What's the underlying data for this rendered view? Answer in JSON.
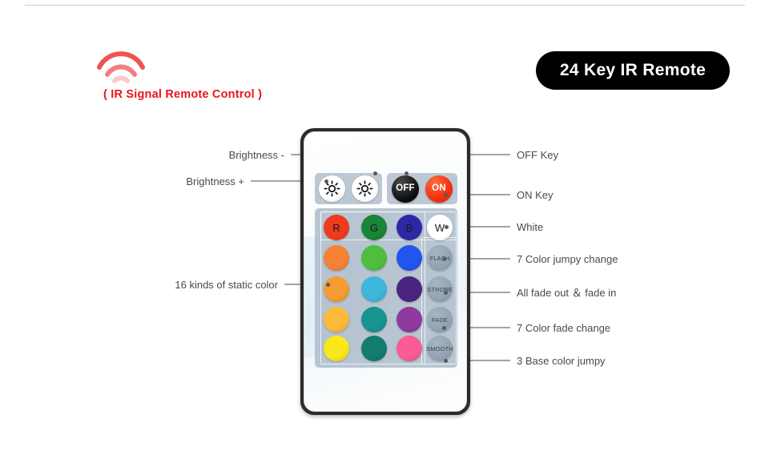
{
  "page": {
    "title": "24 Key IR Remote",
    "ir_caption": "( IR Signal Remote Control )",
    "ir_icon": "ir-signal-wave-icon",
    "accent_red": "#e8151b",
    "pill_background": "#000000",
    "rule_color": "#c9c9c9"
  },
  "remote": {
    "brightness_down": {
      "label": "",
      "icon": "brightness-down-icon"
    },
    "brightness_up": {
      "label": "",
      "icon": "brightness-up-icon"
    },
    "off_button": {
      "label": "OFF",
      "color": "#000000"
    },
    "on_button": {
      "label": "ON",
      "color": "#f4300f"
    },
    "color_rows": [
      [
        {
          "label": "R",
          "color": "#f03a1e"
        },
        {
          "label": "G",
          "color": "#1a8438"
        },
        {
          "label": "B",
          "color": "#2e28a8"
        }
      ],
      [
        {
          "label": "",
          "color": "#f58235"
        },
        {
          "label": "",
          "color": "#4fbe3f"
        },
        {
          "label": "",
          "color": "#2255ee"
        }
      ],
      [
        {
          "label": "",
          "color": "#f79b33"
        },
        {
          "label": "",
          "color": "#3fb6db"
        },
        {
          "label": "",
          "color": "#4b2480"
        }
      ],
      [
        {
          "label": "",
          "color": "#fbba3c"
        },
        {
          "label": "",
          "color": "#17948f"
        },
        {
          "label": "",
          "color": "#8e3a9e"
        }
      ],
      [
        {
          "label": "",
          "color": "#fae81b"
        },
        {
          "label": "",
          "color": "#137b70"
        },
        {
          "label": "",
          "color": "#fa5c93"
        }
      ]
    ],
    "white_button": {
      "label": "W",
      "color": "#ffffff"
    },
    "function_buttons": [
      {
        "label": "FLASH"
      },
      {
        "label": "STROBE"
      },
      {
        "label": "FADE"
      },
      {
        "label": "SMOOTH"
      }
    ]
  },
  "callouts": {
    "left": [
      {
        "label": "Brightness -"
      },
      {
        "label": "Brightness +"
      },
      {
        "label": "16 kinds of static color"
      }
    ],
    "right": [
      {
        "label": "OFF Key"
      },
      {
        "label": "ON Key"
      },
      {
        "label": "White"
      },
      {
        "label": "7 Color jumpy change"
      },
      {
        "label": "All fade out ＆ fade in"
      },
      {
        "label": "7 Color fade change"
      },
      {
        "label": "3 Base color jumpy"
      }
    ]
  }
}
